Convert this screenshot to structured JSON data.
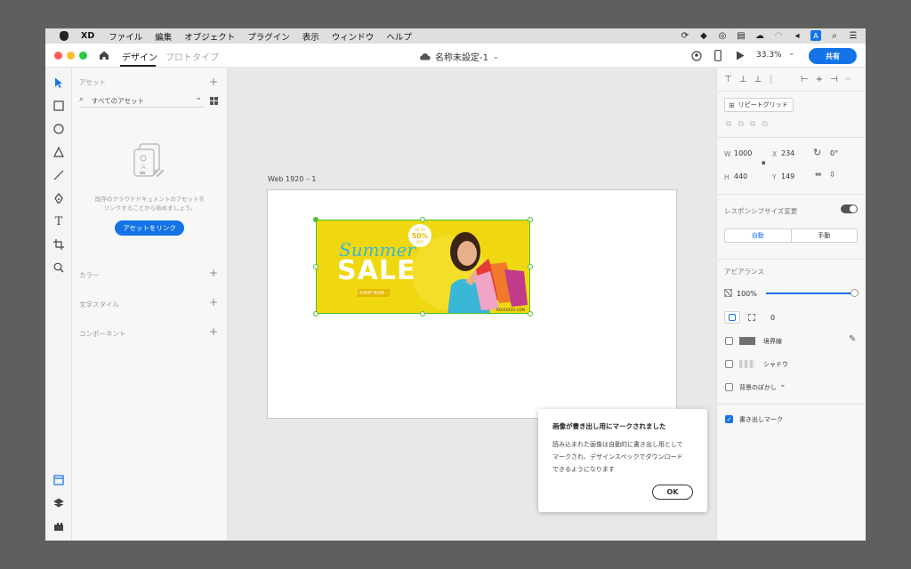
{
  "menubar": {
    "app_name": "XD",
    "items": [
      "ファイル",
      "編集",
      "オブジェクト",
      "プラグイン",
      "表示",
      "ウィンドウ",
      "ヘルプ"
    ]
  },
  "titlebar": {
    "tab_design": "デザイン",
    "tab_prototype": "プロトタイプ",
    "doc_title": "名称未設定-1",
    "zoom": "33.3%",
    "share_label": "共有"
  },
  "assets": {
    "section_label": "アセット",
    "filter_label": "すべてのアセット",
    "empty_message_1": "既存のクラウドドキュメントのアセットを",
    "empty_message_2": "リンクすることから始めましょう。",
    "link_button": "アセットをリンク",
    "colors_label": "カラー",
    "text_styles_label": "文字スタイル",
    "components_label": "コンポーネント"
  },
  "canvas": {
    "artboard_label": "Web 1920 – 1",
    "banner": {
      "title_script": "Summer",
      "title_big": "SALE",
      "badge_top": "UP TO",
      "badge_value": "50%",
      "badge_bottom": "OFF",
      "cta": "SHOP NOW ›",
      "url": "XXXXXXXX.COM"
    }
  },
  "inspector": {
    "repeat_grid": "リピートグリッド",
    "w_label": "W",
    "w_value": "1000",
    "x_label": "X",
    "x_value": "234",
    "rotation_value": "0°",
    "h_label": "H",
    "h_value": "440",
    "y_label": "Y",
    "y_value": "149",
    "responsive_label": "レスポンシブサイズ変更",
    "auto_label": "自動",
    "manual_label": "手動",
    "appearance_label": "アピアランス",
    "opacity_value": "100%",
    "opacity_fraction": 1.0,
    "radius_value": "0",
    "border_label": "境界線",
    "shadow_label": "シャドウ",
    "blur_label": "背景のぼかし",
    "export_mark_label": "書き出しマーク",
    "export_mark_checked": true
  },
  "toast": {
    "title": "画像が書き出し用にマークされました",
    "body_1": "読み込まれた画像は自動的に書き出し用として",
    "body_2": "マークされ、デザインスペックでダウンロード",
    "body_3": "できるようになります",
    "ok_label": "OK"
  },
  "colors": {
    "accent": "#1473e6",
    "banner_bg": "#f0d810",
    "selection": "#4cbf2a"
  }
}
